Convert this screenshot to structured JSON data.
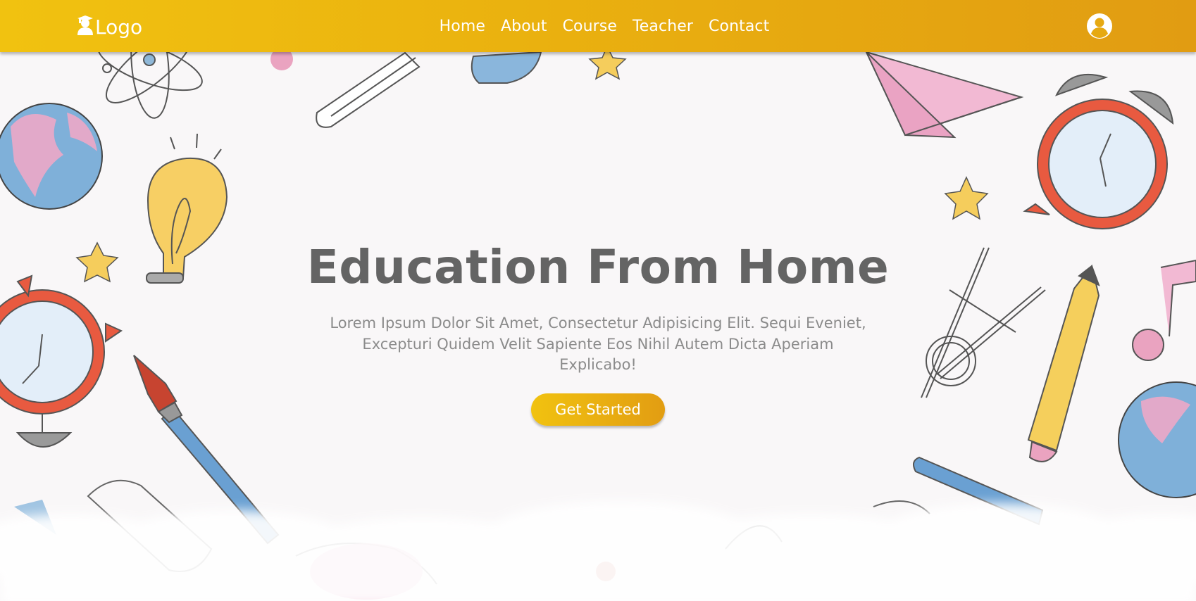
{
  "nav": {
    "logo_text": "Logo",
    "logo_icon": "graduate-icon",
    "links": [
      "Home",
      "About",
      "Course",
      "Teacher",
      "Contact"
    ],
    "user_icon": "user-circle-icon"
  },
  "hero": {
    "title": "Education From Home",
    "subtitle": "Lorem Ipsum Dolor Sit Amet, Consectetur Adipisicing Elit. Sequi Eveniet, Excepturi Quidem Velit Sapiente Eos Nihil Autem Dicta Aperiam Explicabo!",
    "cta_label": "Get Started"
  },
  "colors": {
    "nav_gradient_start": "#f1c210",
    "nav_gradient_end": "#e19c12",
    "title": "#646464",
    "subtitle": "#8b8b8b",
    "background": "#f9f7f8"
  }
}
